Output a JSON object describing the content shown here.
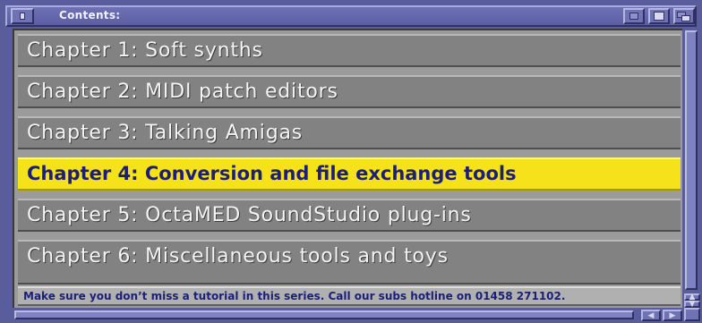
{
  "window": {
    "title": "Contents:"
  },
  "chapters": [
    {
      "label": "Chapter 1: Soft synths",
      "selected": false
    },
    {
      "label": "Chapter 2: MIDI patch editors",
      "selected": false
    },
    {
      "label": "Chapter 3: Talking Amigas",
      "selected": false
    },
    {
      "label": "Chapter 4: Conversion and file exchange tools",
      "selected": true
    },
    {
      "label": "Chapter 5: OctaMED SoundStudio plug-ins",
      "selected": false
    },
    {
      "label": "Chapter 6: Miscellaneous tools and toys",
      "selected": false
    }
  ],
  "footer": {
    "text": "Make sure you don’t miss a tutorial in this series. Call our subs hotline on 01458 271102."
  },
  "colors": {
    "window_frame": "#5a5d9c",
    "item_background": "#828282",
    "selected_background": "#f6e21a",
    "selected_text": "#1c1f78",
    "item_text": "#f4f4f4"
  },
  "icons": {
    "close": "close-icon",
    "iconify": "iconify-icon",
    "zoom": "zoom-icon",
    "depth": "depth-icon",
    "scroll_up": "arrow-up-icon",
    "scroll_down": "arrow-down-icon",
    "scroll_left": "arrow-left-icon",
    "scroll_right": "arrow-right-icon",
    "resize": "resize-icon"
  }
}
